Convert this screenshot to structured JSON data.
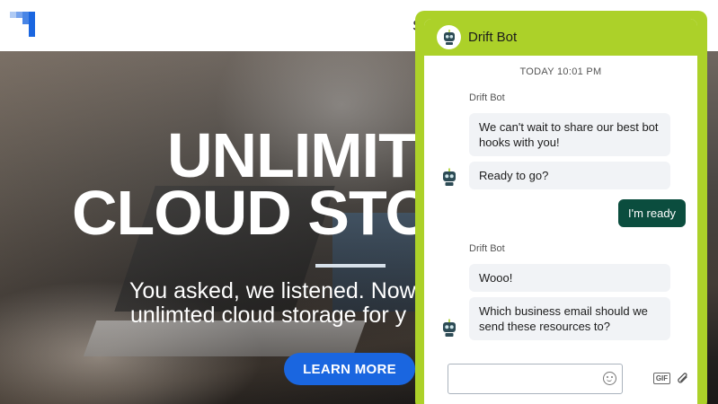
{
  "header": {
    "nav_partial": "So"
  },
  "hero": {
    "headline_line1": "UNLIMITED",
    "headline_line2": "CLOUD STORAGE",
    "subline_line1": "You asked, we listened. Now",
    "subline_line2": "unlimted cloud storage for y",
    "cta_label": "LEARN MORE"
  },
  "chat": {
    "title": "Drift Bot",
    "timestamp": "TODAY 10:01 PM",
    "messages": [
      {
        "sender": "Drift Bot"
      },
      {
        "text": "We can't wait to share our best bot hooks with you!"
      },
      {
        "text": "Ready to go?"
      },
      {
        "text": "I'm ready"
      },
      {
        "sender": "Drift Bot"
      },
      {
        "text": "Wooo!"
      },
      {
        "text": "Which business email should we send these resources to?"
      }
    ],
    "composer": {
      "placeholder": "",
      "gif_label": "GIF"
    }
  },
  "colors": {
    "brand_blue": "#1a66e0",
    "drift_green": "#acd129",
    "user_bubble": "#0b4d3e",
    "bot_bubble": "#f1f3f6"
  },
  "icons": [
    "logo-icon",
    "bot-avatar-icon",
    "emoji-icon",
    "gif-icon",
    "attachment-icon"
  ]
}
